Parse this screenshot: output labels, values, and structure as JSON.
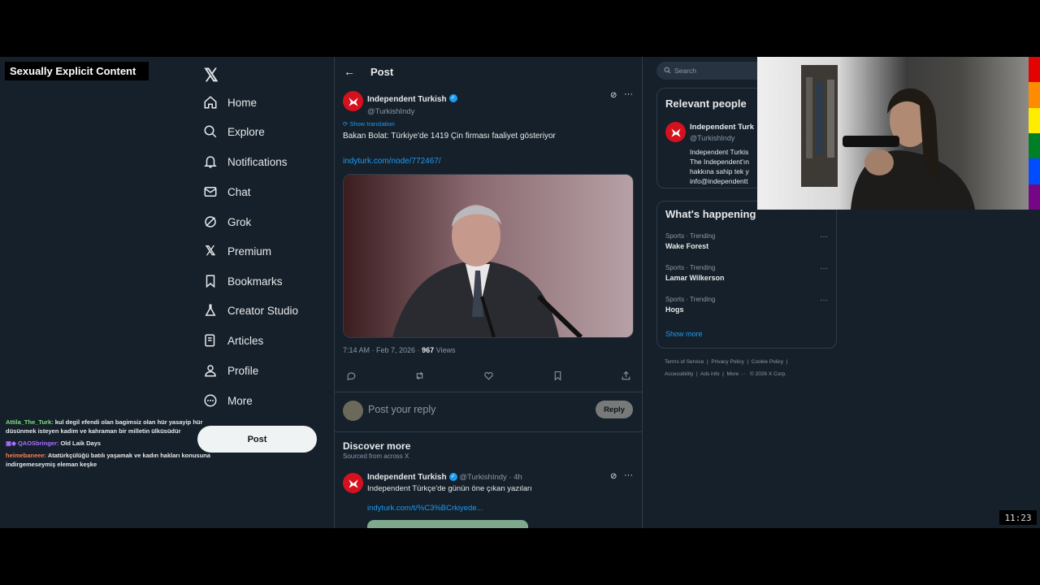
{
  "overlay": {
    "label": "Sexually Explicit Content"
  },
  "nav": {
    "items": [
      {
        "label": "Home",
        "icon": "home-icon"
      },
      {
        "label": "Explore",
        "icon": "search-icon"
      },
      {
        "label": "Notifications",
        "icon": "bell-icon"
      },
      {
        "label": "Chat",
        "icon": "mail-icon"
      },
      {
        "label": "Grok",
        "icon": "grok-icon"
      },
      {
        "label": "Premium",
        "icon": "x-logo-icon"
      },
      {
        "label": "Bookmarks",
        "icon": "bookmark-icon"
      },
      {
        "label": "Creator Studio",
        "icon": "flask-icon"
      },
      {
        "label": "Articles",
        "icon": "article-icon"
      },
      {
        "label": "Profile",
        "icon": "person-icon"
      },
      {
        "label": "More",
        "icon": "more-circle-icon"
      }
    ],
    "post_button": "Post"
  },
  "header": {
    "title": "Post"
  },
  "tweet": {
    "name": "Independent Turkish",
    "handle": "@TurkishIndy",
    "show_translation": "Show translation",
    "text": "Bakan Bolat: Türkiye'de 1419 Çin firması faaliyet gösteriyor",
    "link": "indyturk.com/node/772467/",
    "timestamp": "7:14 AM · Feb 7, 2026 ·",
    "views_count": "967",
    "views_label": "Views"
  },
  "reply": {
    "placeholder": "Post your reply",
    "button": "Reply"
  },
  "discover": {
    "title": "Discover more",
    "subtitle": "Sourced from across X",
    "name": "Independent Turkish",
    "handle": "@TurkishIndy · 4h",
    "text": "Independent Türkçe'de günün öne çıkan yazıları",
    "link": "indyturk.com/t/%C3%BCrkiyede..."
  },
  "sidebar": {
    "search_placeholder": "Search",
    "relevant_title": "Relevant people",
    "person_name": "Independent Turk",
    "person_handle": "@TurkishIndy",
    "bio_lines": [
      "Independent Turkis",
      "The Independent'ın",
      "hakkına sahip tek y",
      "info@independentt"
    ],
    "happening_title": "What's happening",
    "trends": [
      {
        "meta": "Sports · Trending",
        "name": "Wake Forest"
      },
      {
        "meta": "Sports · Trending",
        "name": "Lamar Wilkerson"
      },
      {
        "meta": "Sports · Trending",
        "name": "Hogs"
      }
    ],
    "show_more": "Show more",
    "footer_links": [
      "Terms of Service",
      "|",
      "Privacy Policy",
      "|",
      "Cookie Policy",
      "|",
      "Accessibility",
      "|",
      "Ads info",
      "|",
      "More ···",
      "© 2026 X Corp."
    ]
  },
  "chat": [
    {
      "user": "Attila_The_Turk:",
      "color": "#7ee07e",
      "message": "kul degil efendi olan bagimsiz olan hür yasayip hür düsünmek isteyen kadim ve kahraman bir milletin ülküsüdür"
    },
    {
      "user": "QAOSbringer:",
      "color": "#a970ff",
      "message": "Old Laik Days"
    },
    {
      "user": "heimebaneee:",
      "color": "#ff7f50",
      "message": "Atatürkçülüğü batılı yaşamak ve kadın hakları konusuna indirgemeseymiş eleman keşke"
    }
  ],
  "clock": "11:23",
  "colors": {
    "accent": "#1d9bf0",
    "background": "#15202b",
    "brand_red": "#d6111e"
  }
}
